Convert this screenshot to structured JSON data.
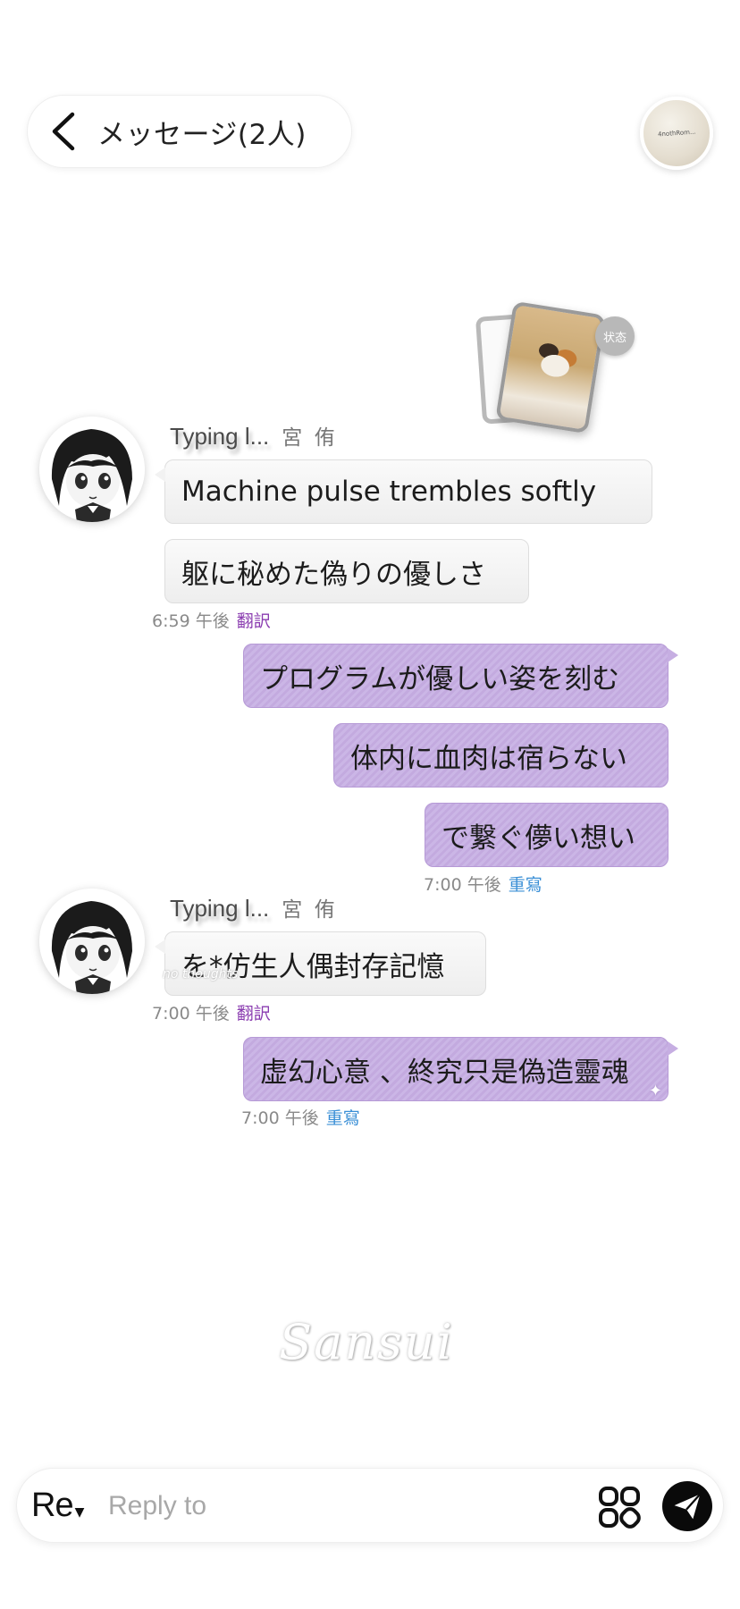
{
  "header": {
    "title": "メッセージ(2人)",
    "back_icon": "chevron-left-icon",
    "avatar_scribble": "4nothRom..."
  },
  "status": {
    "badge_label": "状态"
  },
  "messages": [
    {
      "direction": "incoming",
      "typing_label": "Typing l...",
      "sender_name": "宮 侑",
      "bubbles": [
        "Machine pulse trembles softly",
        "躯に秘めた偽りの優しさ"
      ],
      "time": "6:59 午後",
      "action": "翻訳"
    },
    {
      "direction": "outgoing",
      "bubbles": [
        "プログラムが優しい姿を刻む",
        "体内に血肉は宿らない",
        "で繋ぐ儚い想い"
      ],
      "time": "7:00 午後",
      "action": "重寫"
    },
    {
      "direction": "incoming",
      "typing_label": "Typing l...",
      "sender_name": "宮 侑",
      "bubbles": [
        "を*仿生人偶封存記憶"
      ],
      "time": "7:00 午後",
      "action": "翻訳",
      "ghost": "no thoughts"
    },
    {
      "direction": "outgoing",
      "bubbles": [
        "虚幻心意 、終究只是偽造靈魂"
      ],
      "time": "7:00 午後",
      "action": "重寫"
    }
  ],
  "watermark": "Sansui",
  "composer": {
    "mode_label": "Re",
    "placeholder": "Reply to",
    "value": "",
    "apps_icon": "grid-icon",
    "send_icon": "paper-plane-icon"
  },
  "colors": {
    "outgoing_bubble": "#c6aee2",
    "incoming_bubble": "#f2f2f2",
    "translate_link": "#8a3cb0",
    "rewrite_link": "#3a8fd6"
  }
}
